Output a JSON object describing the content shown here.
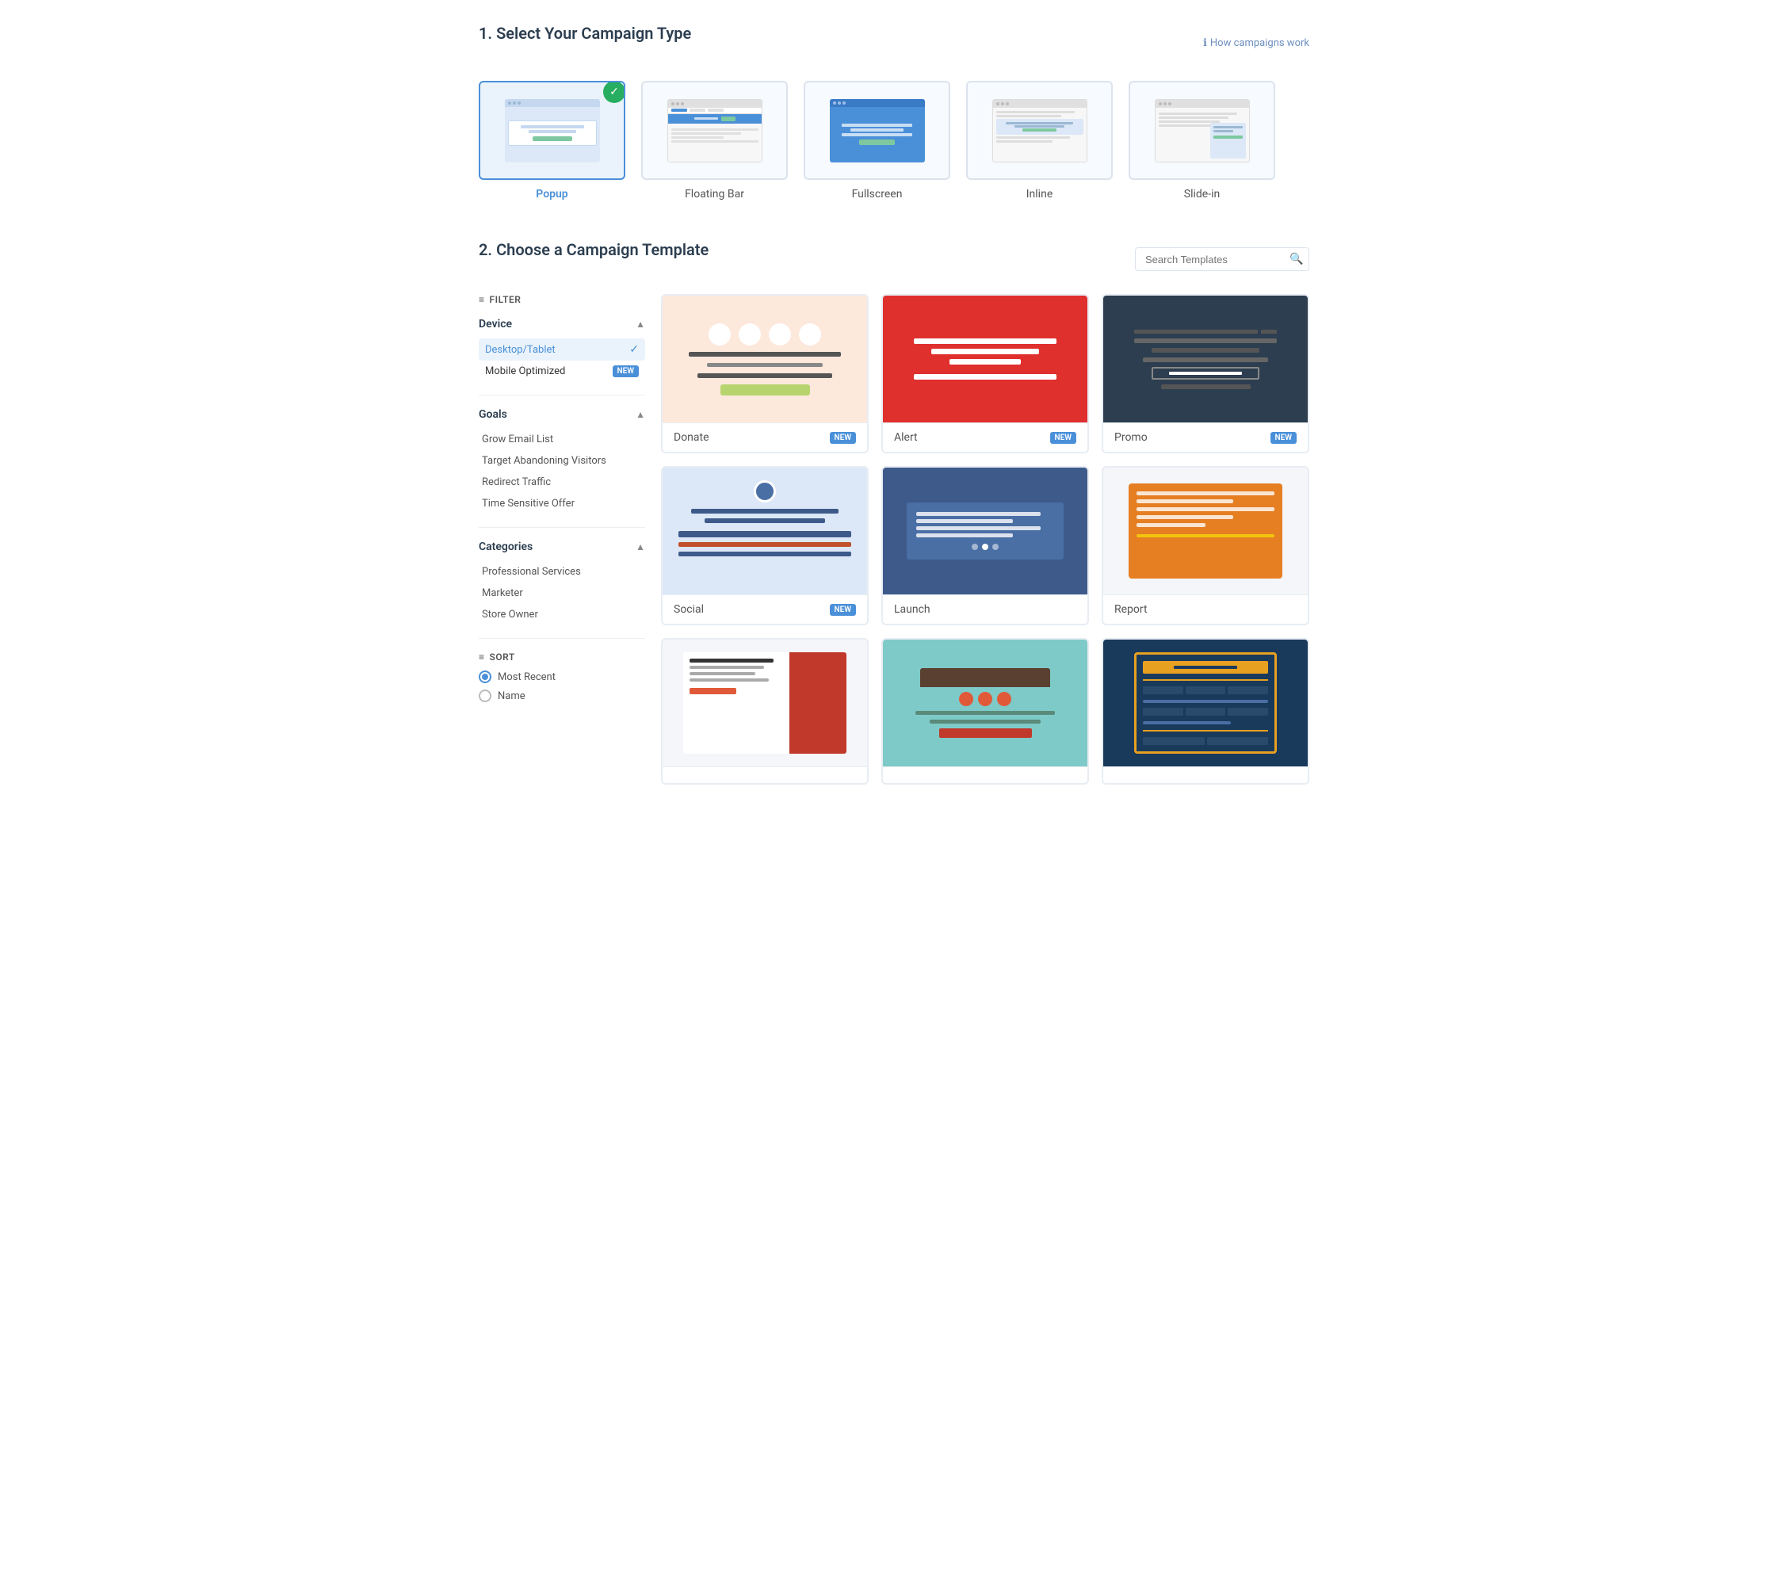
{
  "section1": {
    "title": "1. Select Your Campaign Type",
    "how_campaigns_label": "How campaigns work",
    "types": [
      {
        "id": "popup",
        "label": "Popup",
        "selected": true
      },
      {
        "id": "floating-bar",
        "label": "Floating Bar",
        "selected": false
      },
      {
        "id": "fullscreen",
        "label": "Fullscreen",
        "selected": false
      },
      {
        "id": "inline",
        "label": "Inline",
        "selected": false
      },
      {
        "id": "slide-in",
        "label": "Slide-in",
        "selected": false
      }
    ]
  },
  "section2": {
    "title": "2. Choose a Campaign Template",
    "search_placeholder": "Search Templates",
    "filter_label": "FILTER",
    "sidebar": {
      "device_section": {
        "title": "Device",
        "items": [
          {
            "label": "Desktop/Tablet",
            "active": true
          },
          {
            "label": "Mobile Optimized",
            "badge": "NEW",
            "active": false
          }
        ]
      },
      "goals_section": {
        "title": "Goals",
        "items": [
          {
            "label": "Grow Email List"
          },
          {
            "label": "Target Abandoning Visitors"
          },
          {
            "label": "Redirect Traffic"
          },
          {
            "label": "Time Sensitive Offer"
          }
        ]
      },
      "categories_section": {
        "title": "Categories",
        "items": [
          {
            "label": "Professional Services"
          },
          {
            "label": "Marketer"
          },
          {
            "label": "Store Owner"
          }
        ]
      },
      "sort_section": {
        "title": "SORT",
        "options": [
          {
            "label": "Most Recent",
            "selected": true
          },
          {
            "label": "Name",
            "selected": false
          }
        ]
      }
    },
    "templates": [
      {
        "name": "Donate",
        "badge": "NEW",
        "row": 1
      },
      {
        "name": "Alert",
        "badge": "NEW",
        "row": 1
      },
      {
        "name": "Promo",
        "badge": "NEW",
        "row": 1
      },
      {
        "name": "Social",
        "badge": "NEW",
        "row": 2
      },
      {
        "name": "Launch",
        "badge": "",
        "row": 2
      },
      {
        "name": "Report",
        "badge": "",
        "row": 2
      },
      {
        "name": "",
        "badge": "",
        "row": 3
      },
      {
        "name": "",
        "badge": "",
        "row": 3
      },
      {
        "name": "",
        "badge": "",
        "row": 3
      }
    ]
  }
}
